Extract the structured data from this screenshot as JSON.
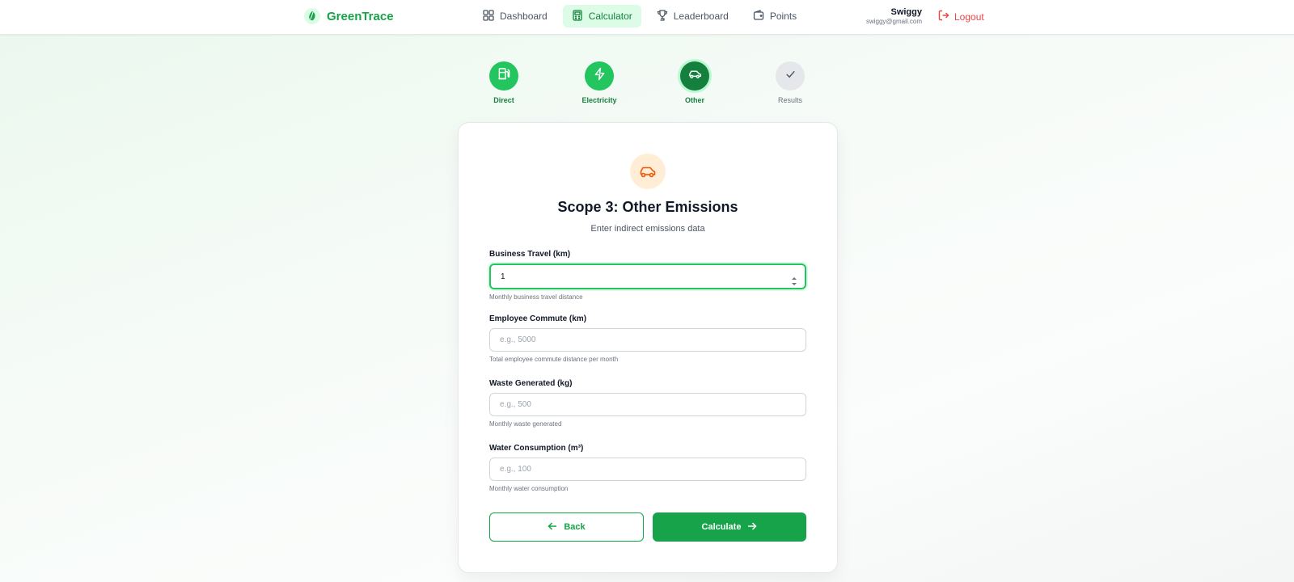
{
  "header": {
    "brand": "GreenTrace",
    "nav": [
      {
        "label": "Dashboard",
        "icon": "dashboard-icon",
        "active": false
      },
      {
        "label": "Calculator",
        "icon": "calculator-icon",
        "active": true
      },
      {
        "label": "Leaderboard",
        "icon": "trophy-icon",
        "active": false
      },
      {
        "label": "Points",
        "icon": "wallet-icon",
        "active": false
      }
    ],
    "user": {
      "name": "Swiggy",
      "email": "swiggy@gmail.com"
    },
    "logout_label": "Logout"
  },
  "stepper": [
    {
      "label": "Direct",
      "icon": "fuel-pump-icon",
      "state": "done"
    },
    {
      "label": "Electricity",
      "icon": "lightning-icon",
      "state": "done"
    },
    {
      "label": "Other",
      "icon": "car-icon",
      "state": "current"
    },
    {
      "label": "Results",
      "icon": "check-icon",
      "state": "pending"
    }
  ],
  "card": {
    "icon": "car-icon",
    "title": "Scope 3: Other Emissions",
    "subtitle": "Enter indirect emissions data",
    "fields": [
      {
        "label": "Business Travel (km)",
        "value": "1",
        "placeholder": "",
        "help": "Monthly business travel distance"
      },
      {
        "label": "Employee Commute (km)",
        "value": "",
        "placeholder": "e.g., 5000",
        "help": "Total employee commute distance per month"
      },
      {
        "label": "Waste Generated (kg)",
        "value": "",
        "placeholder": "e.g., 500",
        "help": "Monthly waste generated"
      },
      {
        "label": "Water Consumption (m³)",
        "value": "",
        "placeholder": "e.g., 100",
        "help": "Monthly water consumption"
      }
    ],
    "back_label": "Back",
    "calculate_label": "Calculate"
  },
  "colors": {
    "primary": "#16a34a",
    "accent_light": "#dcfce7",
    "danger": "#ef4444",
    "icon_bg": "#ffedd5",
    "icon_orange": "#ea580c"
  }
}
